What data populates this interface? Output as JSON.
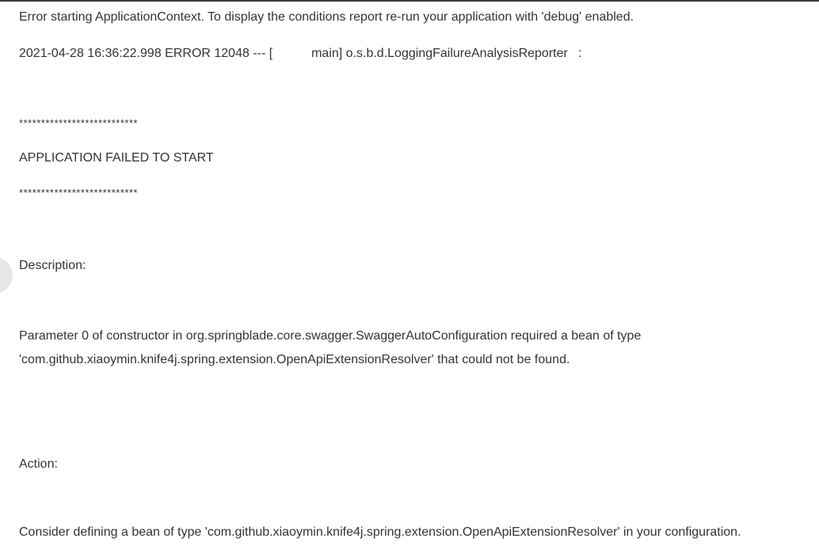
{
  "log": {
    "line1": "Error starting ApplicationContext. To display the conditions report re-run your application with 'debug' enabled.",
    "line2": "2021-04-28 16:36:22.998 ERROR 12048 --- [           main] o.s.b.d.LoggingFailureAnalysisReporter   :",
    "stars_top": "***************************",
    "failed": "APPLICATION FAILED TO START",
    "stars_bottom": "***************************",
    "description_label": "Description:",
    "description_1": "Parameter 0 of constructor in org.springblade.core.swagger.SwaggerAutoConfiguration required a bean of type",
    "description_2": "'com.github.xiaoymin.knife4j.spring.extension.OpenApiExtensionResolver' that could not be found.",
    "action_label": "Action:",
    "action_1": "Consider defining a bean of type 'com.github.xiaoymin.knife4j.spring.extension.OpenApiExtensionResolver' in your configuration."
  }
}
